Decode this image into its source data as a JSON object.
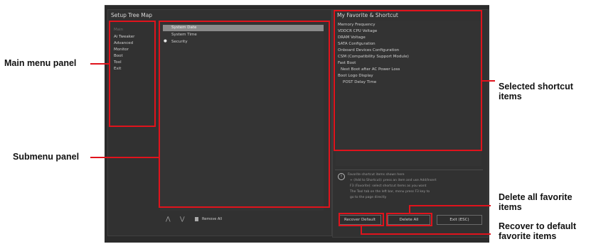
{
  "left_panel": {
    "title": "Setup Tree Map",
    "main_menu": [
      "Main",
      "Ai Tweaker",
      "Advanced",
      "Monitor",
      "Boot",
      "Tool",
      "Exit"
    ],
    "submenu": [
      "System Date",
      "System Time",
      "Security"
    ],
    "bottom_bar": {
      "up_glyph": "⋀",
      "down_glyph": "⋁",
      "delete_glyph": "🗑",
      "delete_label": "Remove All"
    }
  },
  "right_panel": {
    "title": "My Favorite & Shortcut",
    "items": [
      "Memory Frequency",
      "VDDCR CPU Voltage",
      "DRAM Voltage",
      "SATA Configuration",
      "Onboard Devices Configuration",
      "CSM (Compatibility Support Module)",
      "Fast Boot",
      "Next Boot after AC Power Loss",
      "Boot Logo Display",
      "POST Delay Time"
    ],
    "info_icon": "!",
    "info_text": [
      "Favorite shortcut items shown here",
      "+ (Add to Shortcut): press an item and use Add/Insert",
      "F3 (Favorite): select shortcut items as you want",
      "The Tool tab on the left bar, menu press F3 key to",
      "go to the page directly"
    ],
    "buttons": {
      "recover": "Recover Default",
      "delete_all": "Delete All",
      "exit": "Exit (ESC)"
    }
  },
  "annotations": {
    "main_menu_panel": "Main menu panel",
    "submenu_panel": "Submenu panel",
    "selected_shortcut": [
      "Selected shortcut",
      "items"
    ],
    "delete_all": [
      "Delete all favorite",
      "items"
    ],
    "recover_default": [
      "Recover to default",
      "favorite items"
    ]
  },
  "colors": {
    "highlight": "#e0131c",
    "panel_bg": "#313131",
    "screen_bg": "#2b2b2b"
  }
}
